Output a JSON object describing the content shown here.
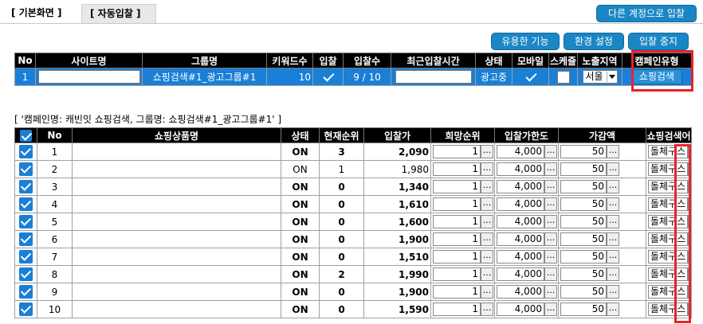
{
  "tabs": [
    "[ 기본화면 ]",
    "[ 자동입찰 ]"
  ],
  "buttons": {
    "other_account": "다른 계정으로 입찰",
    "useful": "유용한 기능",
    "settings": "환경 설정",
    "stop": "입찰 중지"
  },
  "top_table": {
    "headers": [
      "No",
      "사이트명",
      "그룹명",
      "키워드수",
      "입찰",
      "입찰수",
      "최근입찰시간",
      "상태",
      "모바일",
      "스케쥴",
      "노출지역",
      "캠페인유형"
    ],
    "row": {
      "no": "1",
      "group": "쇼핑검색#1_광고그룹#1",
      "keyword_count": "10",
      "bid_count": "9 / 10",
      "status": "광고중",
      "region": "서울",
      "campaign_type": "쇼핑검색"
    }
  },
  "caption": "[ '캠페인명: 캐빈잇 쇼핑검색, 그룹명: 쇼핑검색#1_광고그룹#1' ]",
  "bottom_table": {
    "headers": [
      "No",
      "쇼핑상품명",
      "상태",
      "현재순위",
      "입찰가",
      "희망순위",
      "입찰가한도",
      "가감액",
      "쇼핑검색어"
    ],
    "rows": [
      {
        "no": "1",
        "status": "ON",
        "rank": "3",
        "bid": "2,090",
        "hope": "1",
        "limit": "4,000",
        "delta": "50",
        "kw": "돌체구스"
      },
      {
        "no": "2",
        "status": "ON",
        "rank": "1",
        "bid": "1,980",
        "hope": "1",
        "limit": "4,000",
        "delta": "50",
        "kw": "돌체구스"
      },
      {
        "no": "3",
        "status": "ON",
        "rank": "0",
        "bid": "1,340",
        "hope": "1",
        "limit": "4,000",
        "delta": "50",
        "kw": "돌체구스"
      },
      {
        "no": "4",
        "status": "ON",
        "rank": "0",
        "bid": "1,610",
        "hope": "1",
        "limit": "4,000",
        "delta": "50",
        "kw": "돌체구스"
      },
      {
        "no": "5",
        "status": "ON",
        "rank": "0",
        "bid": "1,600",
        "hope": "1",
        "limit": "4,000",
        "delta": "50",
        "kw": "돌체구스"
      },
      {
        "no": "6",
        "status": "ON",
        "rank": "0",
        "bid": "1,900",
        "hope": "1",
        "limit": "4,000",
        "delta": "50",
        "kw": "돌체구스"
      },
      {
        "no": "7",
        "status": "ON",
        "rank": "0",
        "bid": "1,510",
        "hope": "1",
        "limit": "4,000",
        "delta": "50",
        "kw": "돌체구스"
      },
      {
        "no": "8",
        "status": "ON",
        "rank": "2",
        "bid": "1,990",
        "hope": "1",
        "limit": "4,000",
        "delta": "50",
        "kw": "돌체구스"
      },
      {
        "no": "9",
        "status": "ON",
        "rank": "0",
        "bid": "1,900",
        "hope": "1",
        "limit": "4,000",
        "delta": "50",
        "kw": "돌체구스"
      },
      {
        "no": "10",
        "status": "ON",
        "rank": "0",
        "bid": "1,590",
        "hope": "1",
        "limit": "4,000",
        "delta": "50",
        "kw": "돌체구스"
      }
    ]
  },
  "colors": {
    "accent": "#1a86c4",
    "highlight": "#e8232a",
    "selected_row": "#1a7fd6"
  }
}
